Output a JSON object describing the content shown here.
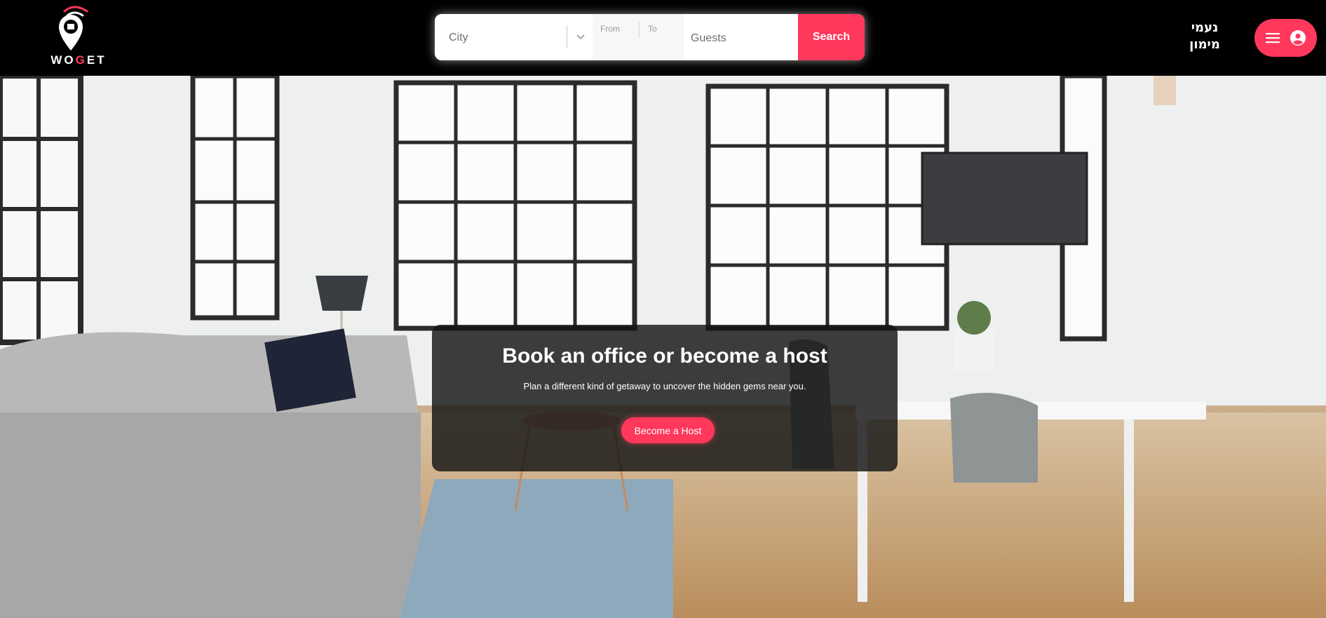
{
  "header": {
    "logo_text_start": "WO",
    "logo_text_accent": "G",
    "logo_text_end": "ET",
    "user_name_line1": "נעמי",
    "user_name_line2": "מימון"
  },
  "search": {
    "city_placeholder": "City",
    "from_label": "From",
    "to_label": "To",
    "guests_placeholder": "Guests",
    "search_label": "Search"
  },
  "hero": {
    "title": "Book an office or become a host",
    "subtitle": "Plan a different kind of getaway to uncover the hidden gems near you.",
    "host_button_label": "Become a Host"
  },
  "colors": {
    "accent": "#ff385c",
    "topbar": "#000000"
  },
  "icons": {
    "logo": "location-pin-wifi-icon",
    "city_dropdown": "chevron-down-icon",
    "menu": "hamburger-menu-icon",
    "profile": "user-circle-icon"
  }
}
